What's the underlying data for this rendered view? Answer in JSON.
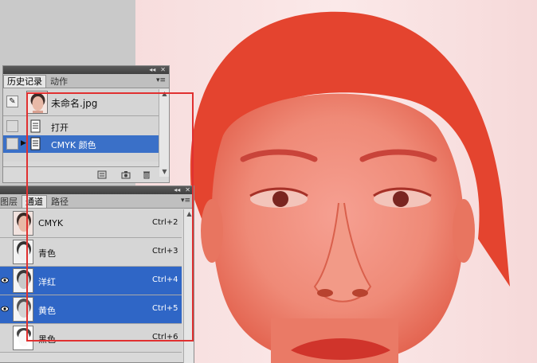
{
  "history_panel": {
    "tabs": [
      {
        "label": "历史记录",
        "active": true
      },
      {
        "label": "动作",
        "active": false
      }
    ],
    "snapshot": {
      "name": "未命名.jpg"
    },
    "states": [
      {
        "label": "打开",
        "selected": false
      },
      {
        "label": "CMYK 颜色",
        "selected": true
      }
    ]
  },
  "channels_panel": {
    "tabs": [
      {
        "label": "图层",
        "active": false
      },
      {
        "label": "通道",
        "active": true
      },
      {
        "label": "路径",
        "active": false
      }
    ],
    "channels": [
      {
        "name": "CMYK",
        "shortcut": "Ctrl+2",
        "visible": false,
        "selected": false
      },
      {
        "name": "青色",
        "shortcut": "Ctrl+3",
        "visible": false,
        "selected": false
      },
      {
        "name": "洋红",
        "shortcut": "Ctrl+4",
        "visible": true,
        "selected": true
      },
      {
        "name": "黄色",
        "shortcut": "Ctrl+5",
        "visible": true,
        "selected": true
      },
      {
        "name": "黑色",
        "shortcut": "Ctrl+6",
        "visible": false,
        "selected": false
      }
    ]
  },
  "colors": {
    "selection_blue": "#2f66c6",
    "annotation_red": "#e03030",
    "portrait_tint": "#e85a45"
  }
}
